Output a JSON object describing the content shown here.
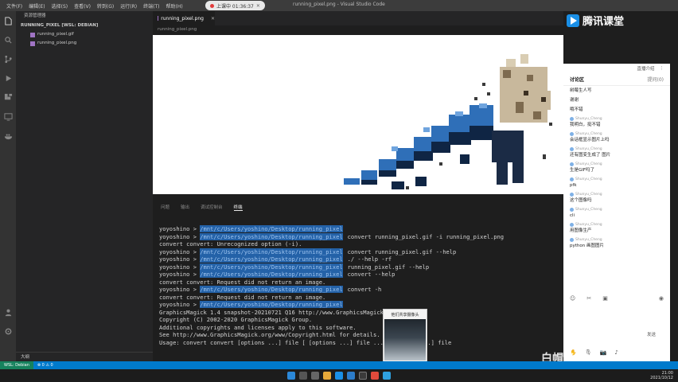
{
  "titlebar": {
    "menus": [
      "文件(F)",
      "编辑(E)",
      "选择(S)",
      "查看(V)",
      "转到(G)",
      "运行(R)",
      "终端(T)",
      "帮助(H)"
    ],
    "window_title": "running_pixel.png - Visual Studio Code",
    "live_status": "上课中 01:36:37"
  },
  "activity_icons": [
    "files-icon",
    "search-icon",
    "source-control-icon",
    "run-debug-icon",
    "extensions-icon",
    "remote-explorer-icon",
    "docker-icon"
  ],
  "explorer": {
    "header": "资源管理器",
    "folder": "RUNNING_PIXEL [WSL: DEBIAN]",
    "files": [
      "running_pixel.gif",
      "running_pixel.png"
    ],
    "outline": "大纲"
  },
  "editor": {
    "tab_label": "running_pixel.png",
    "breadcrumb": "running_pixel.png"
  },
  "panel": {
    "tabs": [
      "问题",
      "输出",
      "调试控制台",
      "终端"
    ],
    "active_tab": "终端"
  },
  "terminal": {
    "lines": [
      {
        "prompt": "yoyoshino > ",
        "path": "/mnt/c/Users/yoshino/Desktop/running_pixel",
        "cmd": ""
      },
      {
        "prompt": "yoyoshino > ",
        "path": "/mnt/c/Users/yoshino/Desktop/running_pixel",
        "cmd": "convert running_pixel.gif -i running_pixel.png"
      },
      {
        "prompt": "",
        "path": "",
        "cmd": "convert convert: Unrecognized option (-i)."
      },
      {
        "prompt": "yoyoshino > ",
        "path": "/mnt/c/Users/yoshino/Desktop/running_pixel",
        "cmd": "convert running_pixel.gif --help"
      },
      {
        "prompt": "yoyoshino > ",
        "path": "/mnt/c/Users/yoshino/Desktop/running_pixel",
        "cmd": "./ --help -rf"
      },
      {
        "prompt": "yoyoshino > ",
        "path": "/mnt/c/Users/yoshino/Desktop/running_pixel",
        "cmd": "running_pixel.gif --help"
      },
      {
        "prompt": "yoyoshino > ",
        "path": "/mnt/c/Users/yoshino/Desktop/running_pixel",
        "cmd": "convert --help"
      },
      {
        "prompt": "",
        "path": "",
        "cmd": "convert convert: Request did not return an image."
      },
      {
        "prompt": "yoyoshino > ",
        "path": "/mnt/c/Users/yoshino/Desktop/running_pixel",
        "cmd": "convert -h"
      },
      {
        "prompt": "",
        "path": "",
        "cmd": "convert convert: Request did not return an image."
      },
      {
        "prompt": "yoyoshino > ",
        "path": "/mnt/c/Users/yoshino/Desktop/running_pixel",
        "cmd": ""
      },
      {
        "prompt": "",
        "path": "",
        "cmd": "GraphicsMagick 1.4 snapshot-20210721 Q16 http://www.GraphicsMagick.org/"
      },
      {
        "prompt": "",
        "path": "",
        "cmd": "Copyright (C) 2002-2020 GraphicsMagick Group."
      },
      {
        "prompt": "",
        "path": "",
        "cmd": "Additional copyrights and licenses apply to this software."
      },
      {
        "prompt": "",
        "path": "",
        "cmd": "See http://www.GraphicsMagick.org/www/Copyright.html for details."
      },
      {
        "prompt": "",
        "path": "",
        "cmd": "Usage: convert convert [options ...] file [ [options ...] file ...] [options ...] file"
      }
    ]
  },
  "chat": {
    "top_link": "直播介绍",
    "tabs": [
      "讨论区",
      "提问(0)"
    ],
    "active_tab": "讨论区",
    "messages": [
      {
        "user": "",
        "text": "树莓生人写"
      },
      {
        "user": "",
        "text": "谢谢"
      },
      {
        "user": "",
        "text": "哦不错"
      },
      {
        "user": "Shunyu_Cheng",
        "text": "我明白，挺不错"
      },
      {
        "user": "Shunyu_Cheng",
        "text": "会话框显示图片上吗"
      },
      {
        "user": "Shunyu_Cheng",
        "text": "还有图变生成了 图片"
      },
      {
        "user": "Shunyu_Cheng",
        "text": "生是GIF吗了"
      },
      {
        "user": "Shunyu_Cheng",
        "text": "pfk"
      },
      {
        "user": "Shunyu_Cheng",
        "text": "这个图像吗"
      },
      {
        "user": "Shunyu_Cheng",
        "text": "cli"
      },
      {
        "user": "Shunyu_Cheng",
        "text": "用图像生产"
      },
      {
        "user": "Shunyu_Cheng",
        "text": "python 画图图片"
      }
    ],
    "send_label": "发送"
  },
  "brand": {
    "logo_text": "腾讯课堂",
    "watermark": "白帽子·皮特"
  },
  "webcam": {
    "label": "他们共享摄像头"
  },
  "statusbar": {
    "remote": "WSL: Debian",
    "errors": "⊗ 0 ⚠ 0"
  },
  "taskbar": {
    "time": "21:00",
    "date": "2021/10/12"
  },
  "colors": {
    "accent": "#007acc",
    "terminal_highlight": "#2462a8",
    "editor_bg": "#1e1e1e",
    "sidebar_bg": "#252526"
  }
}
